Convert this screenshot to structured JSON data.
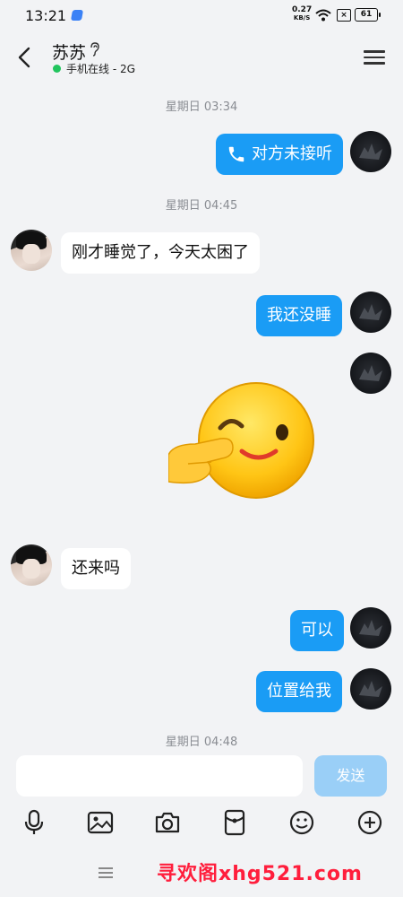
{
  "status_bar": {
    "time": "13:21",
    "net_speed_value": "0.27",
    "net_speed_unit": "KB/S",
    "x_icon_text": "×",
    "battery": "61"
  },
  "header": {
    "contact_name": "苏苏",
    "status_text": "手机在线 - 2G",
    "chevron": "›"
  },
  "messages": {
    "ts1": "星期日 03:34",
    "call_text": "对方未接听",
    "ts2": "星期日 04:45",
    "m1": "刚才睡觉了，今天太困了",
    "m2": "我还没睡",
    "m3": "还来吗",
    "m4": "可以",
    "m5": "位置给我",
    "ts3": "星期日 04:48"
  },
  "composer": {
    "placeholder": "",
    "send_label": "发送"
  },
  "watermark": "寻欢阁xhg521.com",
  "colors": {
    "outgoing_bubble": "#1a9cf5",
    "send_button_disabled": "#9acff7",
    "online": "#22c55e"
  }
}
